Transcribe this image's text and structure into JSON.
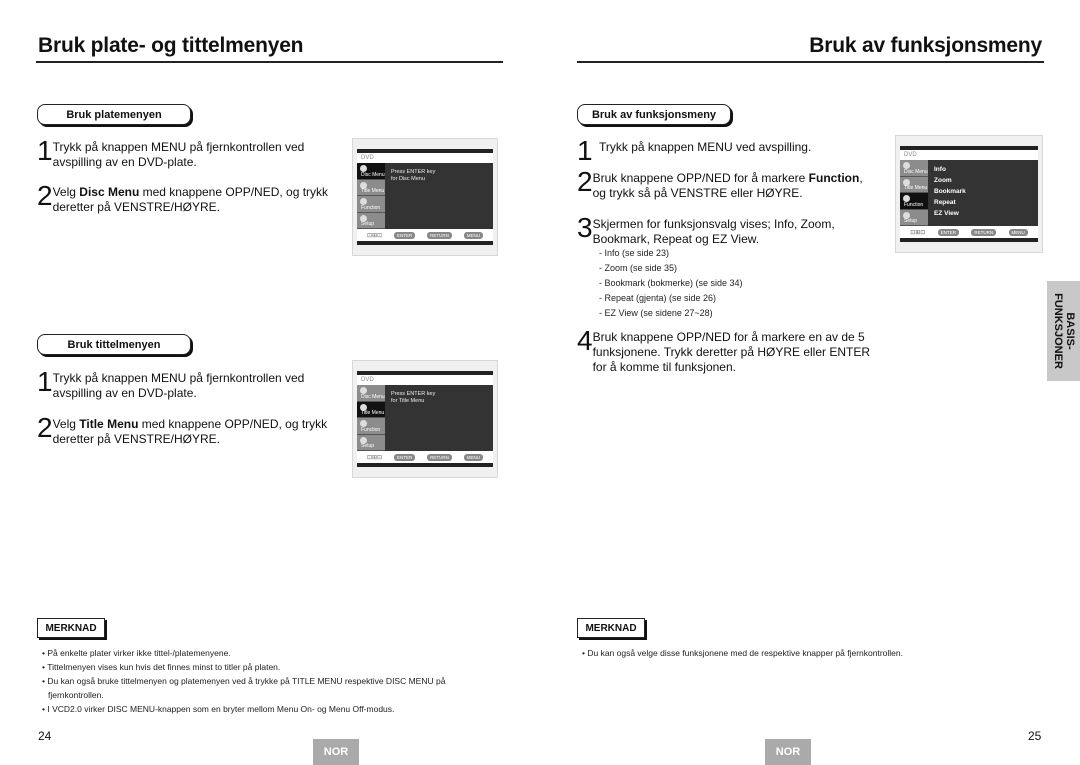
{
  "left_page": {
    "title": "Bruk plate- og tittelmenyen",
    "sections": [
      {
        "tab": "Bruk platemenyen",
        "steps": [
          {
            "num": "1",
            "text": "Trykk på knappen MENU på fjernkontrollen ved avspilling av en DVD-plate."
          },
          {
            "num": "2",
            "pre": "Velg ",
            "bold": "Disc Menu",
            "post": " med knappene OPP/NED, og trykk deretter på VENSTRE/HØYRE."
          }
        ],
        "screen": {
          "header": "DVD",
          "menu": [
            "Disc Menu",
            "Title Menu",
            "Function",
            "Setup"
          ],
          "selected": 0,
          "message": [
            "Press ENTER key",
            "for Disc Menu"
          ],
          "keys": [
            "ENTER",
            "RETURN",
            "MENU"
          ]
        }
      },
      {
        "tab": "Bruk tittelmenyen",
        "steps": [
          {
            "num": "1",
            "text": "Trykk på knappen MENU på fjernkontrollen ved avspilling av en DVD-plate."
          },
          {
            "num": "2",
            "pre": "Velg ",
            "bold": "Title Menu",
            "post": " med knappene OPP/NED, og trykk deretter på VENSTRE/HØYRE."
          }
        ],
        "screen": {
          "header": "DVD",
          "menu": [
            "Disc Menu",
            "Title Menu",
            "Function",
            "Setup"
          ],
          "selected": 1,
          "message": [
            "Press ENTER key",
            "for Title Menu"
          ],
          "keys": [
            "ENTER",
            "RETURN",
            "MENU"
          ]
        }
      }
    ],
    "note_label": "MERKNAD",
    "notes": [
      "På enkelte plater virker ikke tittel-/platemenyene.",
      "Tittelmenyen vises kun hvis det finnes minst to titler på platen.",
      "Du kan også bruke tittelmenyen og platemenyen ved å trykke på TITLE MENU respektive DISC MENU på fjernkontrollen.",
      "I VCD2.0 virker DISC MENU-knappen som en bryter mellom Menu On- og Menu Off-modus."
    ],
    "page_number": "24",
    "lang_badge": "NOR"
  },
  "right_page": {
    "title": "Bruk av funksjonsmeny",
    "section_tab": "Bruk av funksjonsmeny",
    "steps": [
      {
        "num": "1",
        "text": "Trykk på knappen MENU ved avspilling."
      },
      {
        "num": "2",
        "pre": "Bruk knappene OPP/NED for å markere ",
        "bold": "Function",
        "post": ", og trykk så på VENSTRE eller HØYRE."
      },
      {
        "num": "3",
        "text": "Skjermen for funksjonsvalg vises; Info, Zoom, Bookmark, Repeat og EZ View."
      },
      {
        "num": "4",
        "text": "Bruk knappene OPP/NED for å markere en av de 5 funksjonene. Trykk deretter på HØYRE eller ENTER for å komme til funksjonen."
      }
    ],
    "sublist": [
      "-  Info (se side 23)",
      "-  Zoom (se side 35)",
      "-  Bookmark (bokmerke) (se side 34)",
      "-  Repeat (gjenta) (se side 26)",
      "-  EZ View (se sidene 27~28)"
    ],
    "screen": {
      "header": "DVD",
      "menu": [
        "Disc Menu",
        "Title Menu",
        "Function",
        "Setup"
      ],
      "selected": 2,
      "functions": [
        "Info",
        "Zoom",
        "Bookmark",
        "Repeat",
        "EZ View"
      ],
      "keys": [
        "ENTER",
        "RETURN",
        "MENU"
      ]
    },
    "side_tab": [
      "BASIS-",
      "FUNKSJONER"
    ],
    "note_label": "MERKNAD",
    "notes": [
      "Du kan også velge disse funksjonene med de respektive knapper på fjernkontrollen."
    ],
    "page_number": "25",
    "lang_badge": "NOR"
  }
}
